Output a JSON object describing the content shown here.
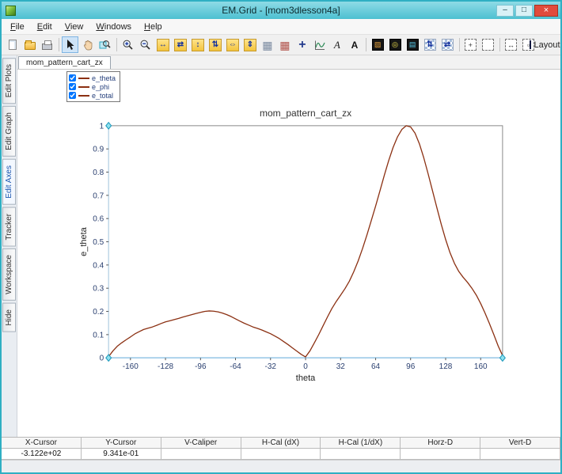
{
  "window": {
    "title": "EM.Grid - [mom3dlesson4a]",
    "controls": {
      "minimize": "–",
      "maximize": "□",
      "close": "×"
    },
    "accent_color": "#2fafc3"
  },
  "menu": {
    "items": [
      "File",
      "Edit",
      "View",
      "Windows",
      "Help"
    ]
  },
  "toolbar": {
    "items": [
      {
        "name": "new-file",
        "icon": "page"
      },
      {
        "name": "open-file",
        "icon": "folder"
      },
      {
        "name": "print",
        "icon": "printer"
      },
      {
        "name": "sep1",
        "icon": "sep"
      },
      {
        "name": "select-tool",
        "icon": "cursor",
        "active": true
      },
      {
        "name": "pan-tool",
        "icon": "hand"
      },
      {
        "name": "zoom-window-tool",
        "icon": "zoombox"
      },
      {
        "name": "sep2",
        "icon": "sep"
      },
      {
        "name": "zoom-in",
        "icon": "zoomin"
      },
      {
        "name": "zoom-out",
        "icon": "zoomout"
      },
      {
        "name": "fit-x-extents",
        "icon": "yellow",
        "glyph": "↔"
      },
      {
        "name": "compress-x",
        "icon": "yellow",
        "glyph": "⇄"
      },
      {
        "name": "fit-y-extents",
        "icon": "yellow",
        "glyph": "↕"
      },
      {
        "name": "compress-y",
        "icon": "yellow",
        "glyph": "⇅"
      },
      {
        "name": "fit-all-extents",
        "icon": "yellow",
        "glyph": "⇔"
      },
      {
        "name": "undo-zoom",
        "icon": "yellow",
        "glyph": "⇕"
      },
      {
        "name": "grid-options",
        "icon": "grid",
        "color": "#7a8aa0",
        "glyph": "▦"
      },
      {
        "name": "data-table",
        "icon": "grid",
        "color": "#b05048",
        "glyph": "▦"
      },
      {
        "name": "add-marker",
        "icon": "plus",
        "glyph": "+"
      },
      {
        "name": "add-curve",
        "icon": "curve"
      },
      {
        "name": "annotation-arrow",
        "icon": "italicA",
        "glyph": "A"
      },
      {
        "name": "add-text",
        "icon": "textA",
        "glyph": "A"
      },
      {
        "name": "sep3",
        "icon": "sep"
      },
      {
        "name": "image-plot",
        "icon": "dark",
        "glyph": "▨",
        "color": "#e8a33d"
      },
      {
        "name": "contour-plot",
        "icon": "dark",
        "glyph": "◎",
        "color": "#f2e24c"
      },
      {
        "name": "surface-plot",
        "icon": "dark",
        "glyph": "▤",
        "color": "#58c8e8"
      },
      {
        "name": "swap-rows",
        "icon": "checker",
        "glyph": "⇅"
      },
      {
        "name": "swap-cols",
        "icon": "checker",
        "glyph": "⇄"
      },
      {
        "name": "sep4",
        "icon": "sep"
      },
      {
        "name": "region-new",
        "icon": "dashed",
        "glyph": "+"
      },
      {
        "name": "region-clear",
        "icon": "dashed",
        "glyph": ""
      },
      {
        "name": "sep5",
        "icon": "sep"
      },
      {
        "name": "region-width",
        "icon": "dashed",
        "glyph": "↔"
      },
      {
        "name": "region-box",
        "icon": "dashed",
        "glyph": "▫"
      },
      {
        "name": "layout",
        "icon": "layout",
        "label": "Layout",
        "caret": "▾"
      }
    ]
  },
  "side_tabs": {
    "items": [
      "Edit Plots",
      "Edit Graph",
      "Edit Axes",
      "Tracker",
      "Workspace",
      "Hide"
    ],
    "active_index": 2
  },
  "doc_tabs": [
    "mom_pattern_cart_zx"
  ],
  "legend": {
    "items": [
      {
        "label": "e_theta",
        "color": "#8b3012",
        "checked": true
      },
      {
        "label": "e_phi",
        "color": "#8b3012",
        "checked": true
      },
      {
        "label": "e_total",
        "color": "#8b3012",
        "checked": true
      }
    ]
  },
  "chart_data": {
    "type": "line",
    "title": "mom_pattern_cart_zx",
    "xlabel": "theta",
    "ylabel": "e_theta",
    "xlim": [
      -180,
      180
    ],
    "ylim": [
      0,
      1
    ],
    "xticks": [
      -160,
      -128,
      -96,
      -64,
      -32,
      0,
      32,
      64,
      96,
      128,
      160
    ],
    "yticks": [
      0,
      0.1,
      0.2,
      0.3,
      0.4,
      0.5,
      0.6,
      0.7,
      0.8,
      0.9,
      1
    ],
    "grid": false,
    "legend_position": "top-left-overlay",
    "series": [
      {
        "name": "e_theta",
        "color": "#8b3012",
        "x_start": -180,
        "x_step": 4,
        "y": [
          0.005,
          0.03,
          0.05,
          0.065,
          0.078,
          0.09,
          0.103,
          0.113,
          0.122,
          0.128,
          0.133,
          0.14,
          0.148,
          0.155,
          0.16,
          0.165,
          0.17,
          0.176,
          0.181,
          0.186,
          0.191,
          0.196,
          0.2,
          0.202,
          0.201,
          0.198,
          0.193,
          0.186,
          0.178,
          0.168,
          0.158,
          0.149,
          0.141,
          0.133,
          0.127,
          0.12,
          0.112,
          0.104,
          0.094,
          0.083,
          0.07,
          0.057,
          0.043,
          0.029,
          0.015,
          0.004,
          0.03,
          0.064,
          0.1,
          0.138,
          0.176,
          0.212,
          0.243,
          0.27,
          0.298,
          0.33,
          0.37,
          0.417,
          0.47,
          0.528,
          0.59,
          0.654,
          0.72,
          0.787,
          0.85,
          0.906,
          0.952,
          0.984,
          1.0,
          0.995,
          0.968,
          0.922,
          0.862,
          0.793,
          0.72,
          0.646,
          0.575,
          0.51,
          0.453,
          0.407,
          0.372,
          0.347,
          0.325,
          0.3,
          0.27,
          0.234,
          0.193,
          0.148,
          0.1,
          0.051,
          0.01
        ]
      }
    ],
    "axis_handles": [
      [
        -180,
        0
      ],
      [
        180,
        0
      ],
      [
        -180,
        1
      ]
    ],
    "handle_color": "#8fe1ef",
    "axis_highlight_color": "#9cc9e8"
  },
  "status_bar": {
    "columns": [
      {
        "header": "X-Cursor",
        "value": "-3.122e+02"
      },
      {
        "header": "Y-Cursor",
        "value": "9.341e-01"
      },
      {
        "header": "V-Caliper",
        "value": ""
      },
      {
        "header": "H-Cal (dX)",
        "value": ""
      },
      {
        "header": "H-Cal (1/dX)",
        "value": ""
      },
      {
        "header": "Horz-D",
        "value": ""
      },
      {
        "header": "Vert-D",
        "value": ""
      }
    ]
  }
}
